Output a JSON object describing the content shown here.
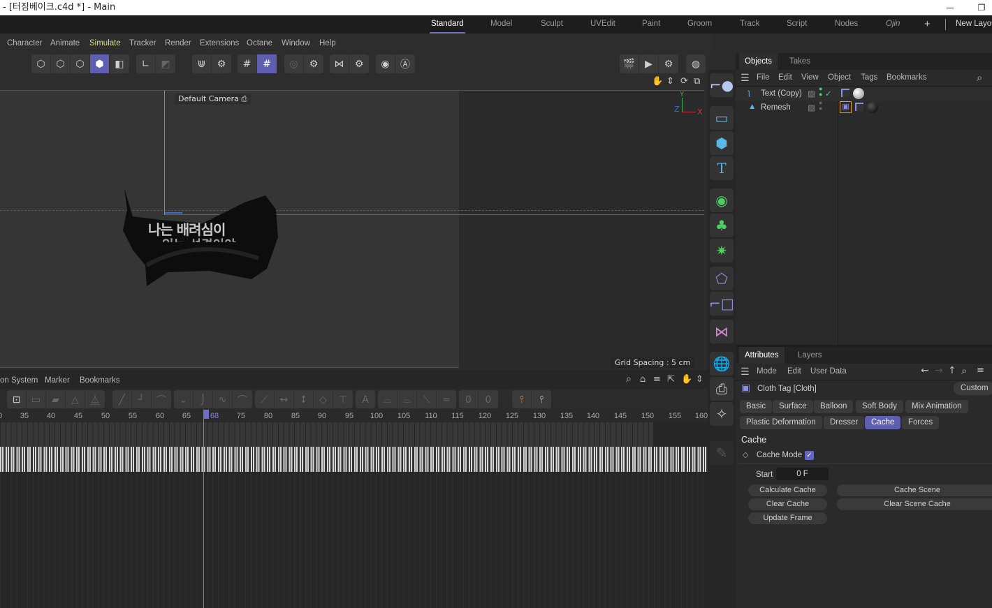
{
  "window": {
    "title": "- [터짐베이크.c4d *] - Main",
    "minimize_glyph": "—",
    "restore_glyph": "❐"
  },
  "layouts": {
    "tabs": [
      {
        "label": "Standard",
        "active": true
      },
      {
        "label": "Model"
      },
      {
        "label": "Sculpt"
      },
      {
        "label": "UVEdit"
      },
      {
        "label": "Paint"
      },
      {
        "label": "Groom"
      },
      {
        "label": "Track"
      },
      {
        "label": "Script"
      },
      {
        "label": "Nodes"
      },
      {
        "label": "Ojin"
      }
    ],
    "add_glyph": "+",
    "new_layout": "New Layout"
  },
  "menu": {
    "items": [
      "Character",
      "Animate",
      "Simulate",
      "Tracker",
      "Render",
      "Extensions",
      "Octane",
      "Window",
      "Help"
    ],
    "highlighted": "Simulate"
  },
  "viewport": {
    "camera_label": "Default Camera",
    "grid_spacing": "Grid Spacing : 5 cm",
    "axis": {
      "y": "Y",
      "x": "X",
      "z": "Z"
    },
    "scene_text_line1": "나는 배려심이",
    "scene_text_line2": "있는 성격이야"
  },
  "objects_panel": {
    "tabs": [
      {
        "label": "Objects",
        "active": true
      },
      {
        "label": "Takes"
      }
    ],
    "menu": [
      "File",
      "Edit",
      "View",
      "Object",
      "Tags",
      "Bookmarks"
    ],
    "rows": [
      {
        "name": "Text (Copy)",
        "enabled_check": "✓"
      },
      {
        "name": "Remesh"
      }
    ]
  },
  "attributes_panel": {
    "tabs": [
      {
        "label": "Attributes",
        "active": true
      },
      {
        "label": "Layers"
      }
    ],
    "menu": [
      "Mode",
      "Edit",
      "User Data"
    ],
    "object_title": "Cloth Tag [Cloth]",
    "mode_dropdown": "Custom",
    "param_tabs_row1": [
      "Basic",
      "Surface",
      "Balloon",
      "Soft Body",
      "Mix Animation"
    ],
    "param_tabs_row2": [
      "Plastic Deformation",
      "Dresser",
      "Cache",
      "Forces"
    ],
    "active_param_tab": "Cache",
    "section_title": "Cache",
    "cache_mode_label": "Cache Mode",
    "cache_mode_checked": true,
    "start_label": "Start",
    "start_value": "0 F",
    "buttons": {
      "calculate_cache": "Calculate Cache",
      "clear_cache": "Clear Cache",
      "update_frame": "Update Frame",
      "cache_scene": "Cache Scene",
      "clear_scene_cache": "Clear Scene Cache"
    }
  },
  "timeline": {
    "menu": [
      "on System",
      "Marker",
      "Bookmarks"
    ],
    "ruler": [
      "0",
      "35",
      "40",
      "45",
      "50",
      "55",
      "60",
      "65",
      "68",
      "75",
      "80",
      "85",
      "90",
      "95",
      "100",
      "105",
      "110",
      "115",
      "120",
      "125",
      "130",
      "135",
      "140",
      "145",
      "150",
      "155",
      "160"
    ],
    "current_frame": "68",
    "end_frame": "150"
  },
  "colors": {
    "accent": "#5e5fb0",
    "simulate_menu": "#d8e08a",
    "axis_x": "#c8393f",
    "axis_y": "#3db061",
    "axis_z": "#3a6fd0",
    "tag_highlight": "#e69a2e"
  }
}
